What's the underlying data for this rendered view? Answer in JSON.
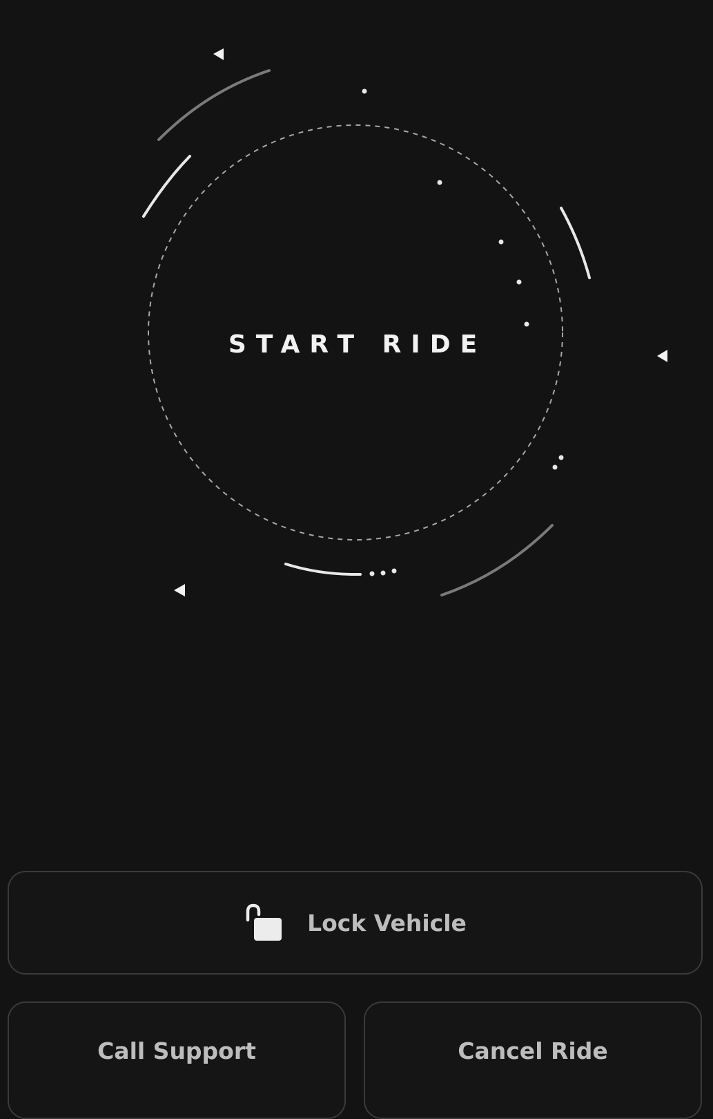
{
  "ride": {
    "start_label": "START RIDE"
  },
  "actions": {
    "lock_label": "Lock Vehicle",
    "lock_icon": "unlocked-padlock-icon",
    "call_label": "Call Support",
    "cancel_label": "Cancel Ride"
  },
  "colors": {
    "background": "#131313",
    "primary_text": "#f2f2f2",
    "button_text": "#bdbdbd",
    "button_border": "#3a3a3a",
    "ring": "#9a9a9a"
  }
}
